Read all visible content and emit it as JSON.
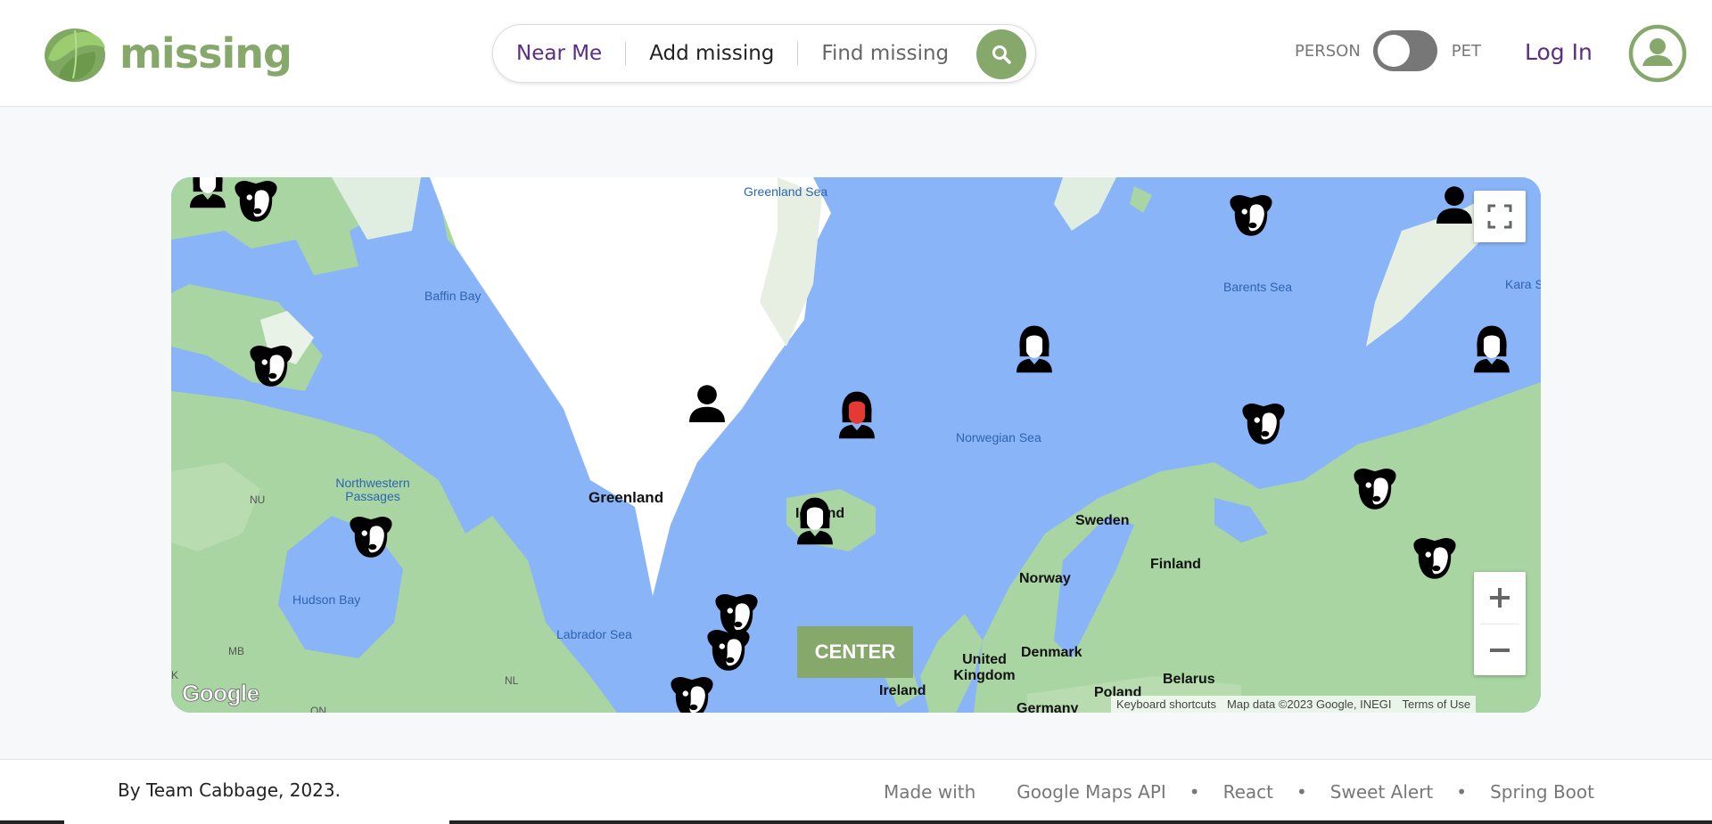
{
  "app": {
    "name": "missing",
    "brand_color": "#86a86a",
    "accent_color": "#5a2d86"
  },
  "nav": {
    "items": [
      {
        "label": "Near Me",
        "state": "active"
      },
      {
        "label": "Add missing",
        "state": "normal"
      },
      {
        "label": "Find missing",
        "state": "placeholder"
      }
    ],
    "search_icon": "search-icon"
  },
  "toggle": {
    "left_label": "PERSON",
    "right_label": "PET",
    "state": "person"
  },
  "auth": {
    "login_label": "Log In",
    "avatar_icon": "user-circle-icon"
  },
  "map": {
    "labels": {
      "greenland_sea": "Greenland Sea",
      "baffin_bay": "Baffin Bay",
      "barents_sea": "Barents Sea",
      "kara_sea": "Kara S",
      "norwegian_sea": "Norwegian Sea",
      "northwestern_passages": "Northwestern Passages",
      "nu": "NU",
      "greenland": "Greenland",
      "iceland": "Iceland",
      "sweden": "Sweden",
      "finland": "Finland",
      "norway": "Norway",
      "hudson_bay": "Hudson Bay",
      "labrador_sea": "Labrador Sea",
      "mb": "MB",
      "nl": "NL",
      "k": "K",
      "on": "ON",
      "denmark": "Denmark",
      "united_kingdom": "United Kingdom",
      "ireland": "Ireland",
      "belarus": "Belarus",
      "poland": "Poland",
      "germany": "Germany"
    },
    "controls": {
      "fullscreen_icon": "fullscreen-icon",
      "zoom_in_icon": "plus-icon",
      "zoom_out_icon": "minus-icon",
      "center_label": "CENTER"
    },
    "google_logo": "Google",
    "attribution": {
      "shortcuts": "Keyboard shortcuts",
      "data": "Map data ©2023 Google, INEGI",
      "terms": "Terms of Use"
    },
    "markers": [
      {
        "kind": "person-woman",
        "highlight": false
      },
      {
        "kind": "pet-dog",
        "highlight": false
      },
      {
        "kind": "pet-dog",
        "highlight": false
      },
      {
        "kind": "person",
        "highlight": false
      },
      {
        "kind": "pet-dog",
        "highlight": false
      },
      {
        "kind": "pet-dog",
        "highlight": false
      },
      {
        "kind": "person",
        "highlight": false
      },
      {
        "kind": "person-woman",
        "highlight": true
      },
      {
        "kind": "person-woman",
        "highlight": false
      },
      {
        "kind": "person-woman",
        "highlight": false
      },
      {
        "kind": "pet-dog",
        "highlight": false
      },
      {
        "kind": "person-woman",
        "highlight": false
      },
      {
        "kind": "pet-dog",
        "highlight": false
      },
      {
        "kind": "pet-dog",
        "highlight": false
      },
      {
        "kind": "pet-dog",
        "highlight": false
      },
      {
        "kind": "pet-dog",
        "highlight": false
      },
      {
        "kind": "pet-dog",
        "highlight": false
      },
      {
        "kind": "pet-dog",
        "highlight": false
      }
    ]
  },
  "footer": {
    "credit": "By Team Cabbage, 2023.",
    "made_with_label": "Made with",
    "separator": "•",
    "tech": [
      "Google Maps API",
      "React",
      "Sweet Alert",
      "Spring Boot"
    ]
  }
}
